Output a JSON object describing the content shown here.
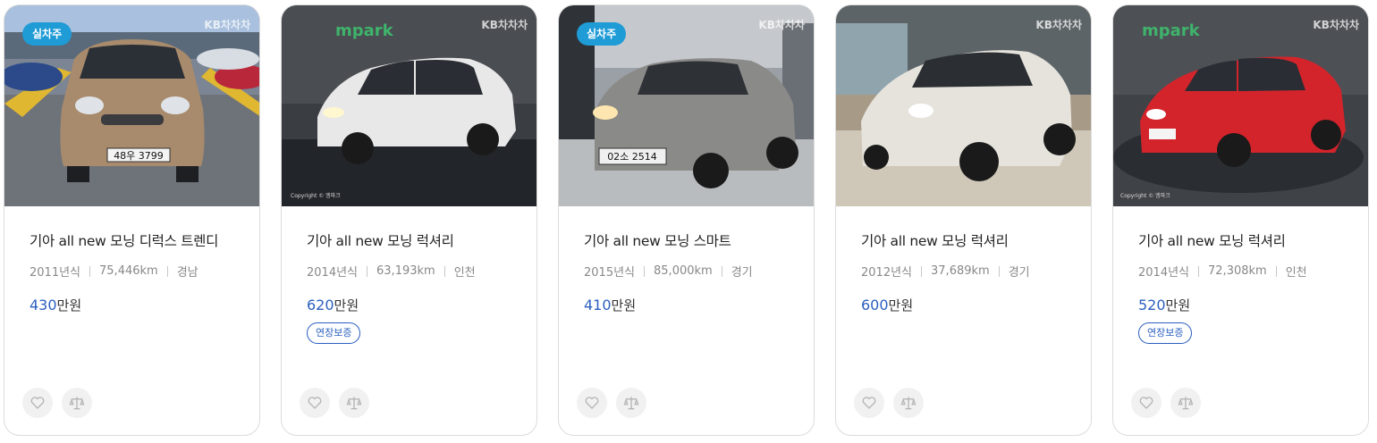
{
  "cards": [
    {
      "badge": "실차주",
      "brand": "KB차차차",
      "title": "기아 all new 모닝 디럭스 트렌디",
      "year": "2011년식",
      "mileage": "75,446km",
      "region": "경남",
      "price": "430",
      "price_unit": "만원",
      "tag": "",
      "car_color": "#a88a6c",
      "plate": "48우 3799"
    },
    {
      "badge": "",
      "brand": "KB차차차",
      "logo": "mpark",
      "copyright": "Copyright © 엠파크",
      "title": "기아 all new 모닝 럭셔리",
      "year": "2014년식",
      "mileage": "63,193km",
      "region": "인천",
      "price": "620",
      "price_unit": "만원",
      "tag": "연장보증",
      "car_color": "#e8e8e8"
    },
    {
      "badge": "실차주",
      "brand": "KB차차차",
      "title": "기아 all new 모닝 스마트",
      "year": "2015년식",
      "mileage": "85,000km",
      "region": "경기",
      "price": "410",
      "price_unit": "만원",
      "tag": "",
      "car_color": "#8a8a88",
      "plate": "02소 2514"
    },
    {
      "badge": "",
      "brand": "KB차차차",
      "title": "기아 all new 모닝 럭셔리",
      "year": "2012년식",
      "mileage": "37,689km",
      "region": "경기",
      "price": "600",
      "price_unit": "만원",
      "tag": "",
      "car_color": "#e6e3dc"
    },
    {
      "badge": "",
      "brand": "KB차차차",
      "logo": "mpark",
      "copyright": "Copyright © 엠파크",
      "title": "기아 all new 모닝 럭셔리",
      "year": "2014년식",
      "mileage": "72,308km",
      "region": "인천",
      "price": "520",
      "price_unit": "만원",
      "tag": "연장보증",
      "car_color": "#d4242b"
    }
  ],
  "icons": {
    "favorite": "heart-icon",
    "compare": "scale-icon"
  }
}
